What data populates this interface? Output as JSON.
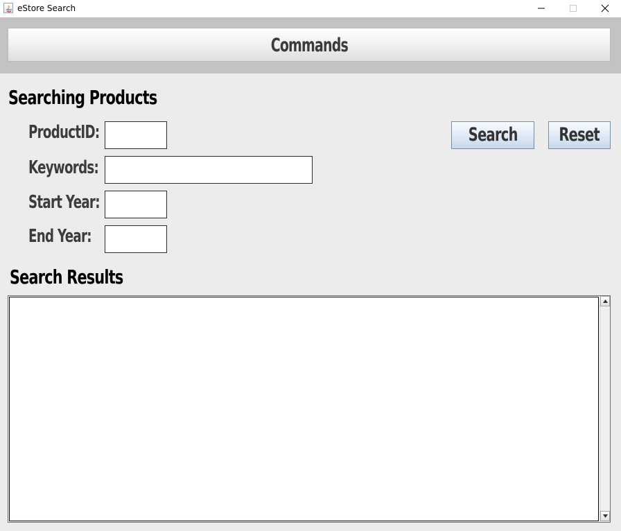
{
  "window": {
    "title": "eStore Search",
    "icons": {
      "app": "java-coffee-cup-icon",
      "minimize": "minimize-icon",
      "maximize": "maximize-icon",
      "close": "close-icon"
    }
  },
  "commands": {
    "label": "Commands"
  },
  "search_section": {
    "heading": "Searching Products",
    "fields": {
      "product_id": {
        "label": "ProductID:",
        "value": ""
      },
      "keywords": {
        "label": "Keywords:",
        "value": ""
      },
      "start_year": {
        "label": "Start Year:",
        "value": ""
      },
      "end_year": {
        "label": "End Year:",
        "value": ""
      }
    },
    "buttons": {
      "search": "Search",
      "reset": "Reset"
    }
  },
  "results_section": {
    "heading": "Search Results",
    "content": ""
  },
  "colors": {
    "window_bg": "#ececec",
    "commands_band": "#c3c3c3",
    "action_button_top": "#f7fbff",
    "action_button_bottom": "#c7d7e9"
  }
}
